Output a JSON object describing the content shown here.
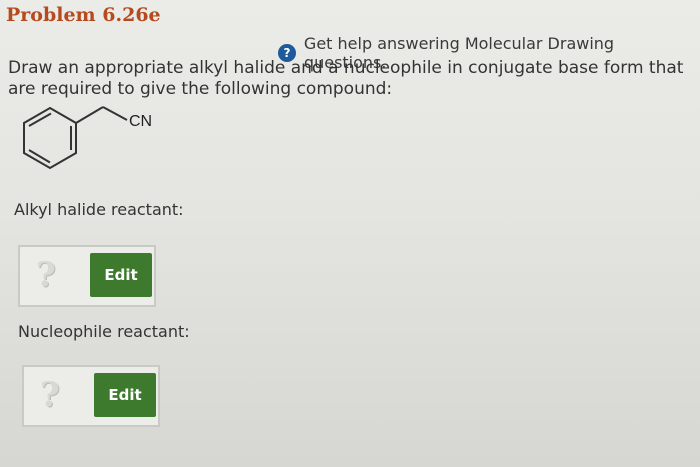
{
  "problem": {
    "title": "Problem 6.26e",
    "help_link": "Get help answering Molecular Drawing questions.",
    "question": "Draw an appropriate alkyl halide and a nucleophile in conjugate base form that are required to give the following compound:"
  },
  "compound": {
    "group_label": "CN"
  },
  "alkyl_halide": {
    "label": "Alkyl halide reactant:",
    "placeholder": "?",
    "edit_label": "Edit"
  },
  "nucleophile": {
    "label": "Nucleophile reactant:",
    "placeholder": "?",
    "edit_label": "Edit"
  },
  "colors": {
    "title": "#b54a1e",
    "help_icon": "#1f5a9a",
    "edit_button": "#3e7a2e"
  }
}
